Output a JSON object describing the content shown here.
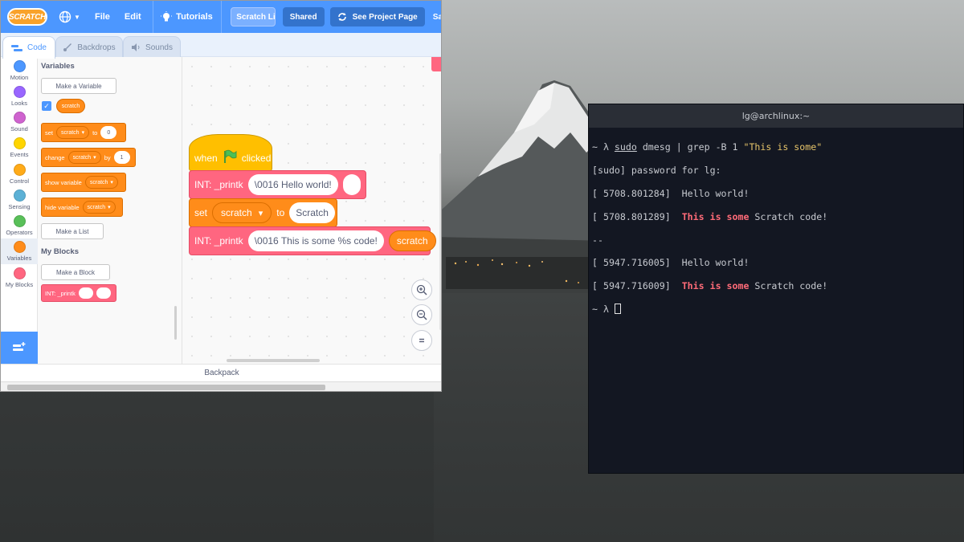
{
  "scratch": {
    "menubar": {
      "logo": "SCRATCH",
      "file": "File",
      "edit": "Edit",
      "tutorials": "Tutorials",
      "project_title": "Scratch Linux Kern...",
      "shared": "Shared",
      "see_project_page": "See Project Page",
      "cut_item": "Sa"
    },
    "tabs": {
      "code": "Code",
      "backdrops": "Backdrops",
      "sounds": "Sounds"
    },
    "categories": [
      {
        "label": "Motion",
        "color": "#4c97ff"
      },
      {
        "label": "Looks",
        "color": "#9966ff"
      },
      {
        "label": "Sound",
        "color": "#cf63cf"
      },
      {
        "label": "Events",
        "color": "#ffd500"
      },
      {
        "label": "Control",
        "color": "#ffab19"
      },
      {
        "label": "Sensing",
        "color": "#5cb1d6"
      },
      {
        "label": "Operators",
        "color": "#59c059"
      },
      {
        "label": "Variables",
        "color": "#ff8c1a"
      },
      {
        "label": "My Blocks",
        "color": "#ff6680"
      }
    ],
    "palette": {
      "variables_heading": "Variables",
      "make_variable": "Make a Variable",
      "variable_name": "scratch",
      "set_block": {
        "verb": "set",
        "var": "scratch",
        "to": "to",
        "value": "0"
      },
      "change_block": {
        "verb": "change",
        "var": "scratch",
        "by": "by",
        "value": "1"
      },
      "show_block": {
        "verb": "show variable",
        "var": "scratch"
      },
      "hide_block": {
        "verb": "hide variable",
        "var": "scratch"
      },
      "make_list": "Make a List",
      "myblocks_heading": "My Blocks",
      "make_block": "Make a Block",
      "printk_block": "INT: _printk"
    },
    "script": {
      "hat_when": "when",
      "hat_clicked": "clicked",
      "printk1_label": "INT: _printk",
      "printk1_arg": "\\0016 Hello world!",
      "set_label": "set",
      "set_var": "scratch",
      "set_to": "to",
      "set_value": "Scratch",
      "printk2_label": "INT: _printk",
      "printk2_arg": "\\0016 This is some %s code!",
      "printk2_var": "scratch"
    },
    "backpack": "Backpack",
    "colors": {
      "accent": "#4c97ff",
      "variables": "#ff8c1a",
      "myblocks": "#ff6680",
      "events": "#ffbf00"
    }
  },
  "terminal": {
    "title": "lg@archlinux:~",
    "lines": {
      "l1_prompt": "~ λ ",
      "l1_sudo": "sudo",
      "l1_rest": " dmesg | grep -B 1 ",
      "l1_string": "\"This is some\"",
      "l2": "[sudo] password for lg:",
      "l3": "[ 5708.801284]  Hello world!",
      "l4_ts": "[ 5708.801289]  ",
      "l4_hi": "This is some",
      "l4_rest": " Scratch code!",
      "l5": "--",
      "l6": "[ 5947.716005]  Hello world!",
      "l7_ts": "[ 5947.716009]  ",
      "l7_hi": "This is some",
      "l7_rest": " Scratch code!",
      "l8_prompt": "~ λ "
    },
    "colors": {
      "highlight": "#ff6b78",
      "string": "#e6c46a",
      "background": "#131722"
    }
  }
}
